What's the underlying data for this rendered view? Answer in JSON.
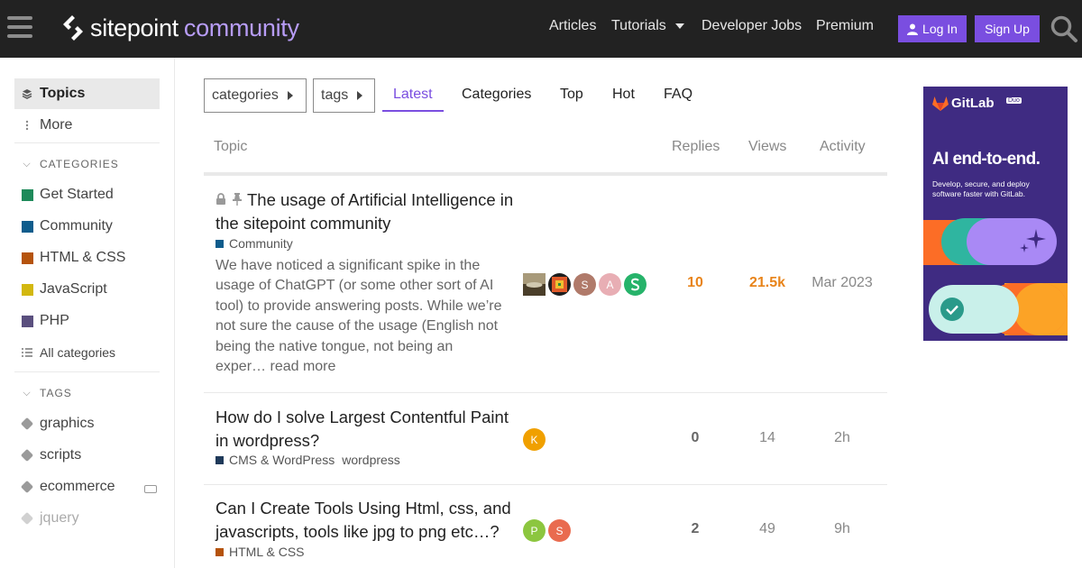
{
  "header": {
    "logo": {
      "word1": "sitepoint",
      "word2": "community"
    },
    "nav": [
      {
        "label": "Articles"
      },
      {
        "label": "Tutorials"
      },
      {
        "label": "Developer Jobs"
      },
      {
        "label": "Premium"
      }
    ],
    "login_label": "Log In",
    "signup_label": "Sign Up"
  },
  "sidebar": {
    "topics_label": "Topics",
    "more_label": "More",
    "categories_heading": "CATEGORIES",
    "categories": [
      {
        "label": "Get Started",
        "color": "#1e8a5a"
      },
      {
        "label": "Community",
        "color": "#0e5c8c"
      },
      {
        "label": "HTML & CSS",
        "color": "#b5530c"
      },
      {
        "label": "JavaScript",
        "color": "#d3b80f"
      },
      {
        "label": "PHP",
        "color": "#5a4f7e"
      }
    ],
    "all_categories_label": "All categories",
    "tags_heading": "TAGS",
    "tags": [
      {
        "label": "graphics"
      },
      {
        "label": "scripts"
      },
      {
        "label": "ecommerce"
      },
      {
        "label": "jquery"
      }
    ]
  },
  "filters": {
    "categories_label": "categories",
    "tags_label": "tags"
  },
  "tabs": [
    {
      "label": "Latest"
    },
    {
      "label": "Categories"
    },
    {
      "label": "Top"
    },
    {
      "label": "Hot"
    },
    {
      "label": "FAQ"
    }
  ],
  "columns": {
    "topic": "Topic",
    "replies": "Replies",
    "views": "Views",
    "activity": "Activity"
  },
  "topics": [
    {
      "title_line1": "The usage of Artificial Intelligence in",
      "title_line2": "the sitepoint community",
      "category": "Community",
      "category_color": "#0e5c8c",
      "excerpt": "We have noticed a significant spike in the usage of ChatGPT (or some other sort of AI tool) to provide answering posts. While we’re not sure the cause of the usage (English not being the native tongue, not being an exper…",
      "read_more": "read more",
      "avatars": [
        {
          "letter": "",
          "color": "#7a6a4a"
        },
        {
          "letter": "",
          "color": "#c0392b"
        },
        {
          "letter": "S",
          "color": "#b07a6a"
        },
        {
          "letter": "A",
          "color": "#e8aeb4"
        },
        {
          "letter": "S",
          "color": "#26b36a"
        }
      ],
      "replies": "10",
      "views": "21.5k",
      "activity": "Mar 2023"
    },
    {
      "title_line1": "How do I solve Largest Contentful Paint",
      "title_line2": "in wordpress?",
      "category": "CMS & WordPress",
      "category_color": "#1f3a5a",
      "tag": "wordpress",
      "avatars": [
        {
          "letter": "K",
          "color": "#f0a000"
        }
      ],
      "replies": "0",
      "views": "14",
      "activity": "2h"
    },
    {
      "title_line1": "Can I Create Tools Using Html, css, and",
      "title_line2": "javascripts, tools like jpg to png etc…?",
      "category": "HTML & CSS",
      "category_color": "#b5530c",
      "avatars": [
        {
          "letter": "P",
          "color": "#8cc63f"
        },
        {
          "letter": "S",
          "color": "#e96b4f"
        }
      ],
      "replies": "2",
      "views": "49",
      "activity": "9h"
    }
  ],
  "ad": {
    "brand": "GitLab",
    "badge": "Duo",
    "headline": "AI end-to-end.",
    "sub_line1": "Develop, secure, and deploy",
    "sub_line2": "software faster with GitLab."
  }
}
